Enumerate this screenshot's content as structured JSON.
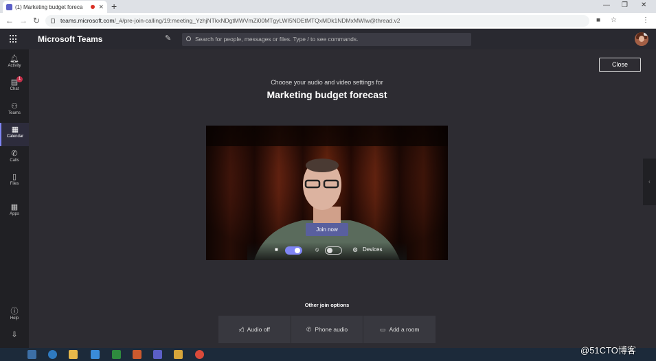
{
  "browser": {
    "tab_title": "(1) Marketing budget foreca",
    "url_host": "teams.microsoft.com",
    "url_path": "/_#/pre-join-calling/19:meeting_YzhjNTkxNDgtMWVmZi00MTgyLWI5NDEtMTQxMDk1NDMxMWIw@thread.v2"
  },
  "app": {
    "title": "Microsoft Teams"
  },
  "search": {
    "placeholder": "Search for people, messages or files. Type / to see commands."
  },
  "rail": [
    {
      "label": "Activity",
      "icon": "bell-icon"
    },
    {
      "label": "Chat",
      "icon": "chat-icon",
      "badge": "1"
    },
    {
      "label": "Teams",
      "icon": "teams-icon"
    },
    {
      "label": "Calendar",
      "icon": "calendar-icon"
    },
    {
      "label": "Calls",
      "icon": "phone-icon"
    },
    {
      "label": "Files",
      "icon": "file-icon"
    },
    {
      "label": "Apps",
      "icon": "apps-icon"
    },
    {
      "label": "Help",
      "icon": "help-icon"
    }
  ],
  "prejoin": {
    "close": "Close",
    "subtitle": "Choose your audio and video settings for",
    "meeting_title": "Marketing budget forecast",
    "join_button": "Join now",
    "devices": "Devices",
    "other_join_title": "Other join options",
    "options": [
      "Audio off",
      "Phone audio",
      "Add a room"
    ]
  },
  "watermark": "@51CTO博客",
  "colors": {
    "accent": "#7f85f5",
    "join": "#595f9e",
    "rail": "#202024",
    "stage": "#2d2c32"
  }
}
